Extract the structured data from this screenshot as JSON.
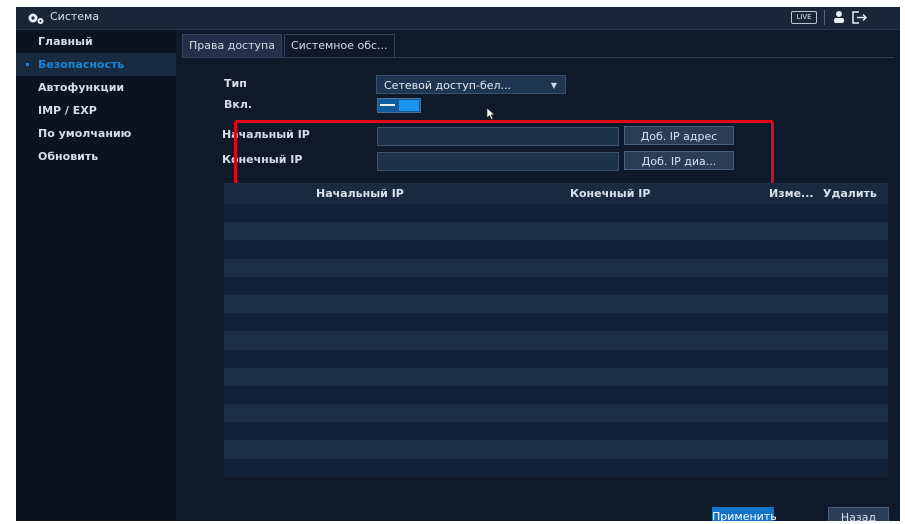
{
  "topbar": {
    "title": "Система",
    "live_label": "LIVE",
    "icons": [
      "gear-icon",
      "user-icon",
      "logout-icon"
    ]
  },
  "sidebar": {
    "items": [
      {
        "label": "Главный",
        "active": false
      },
      {
        "label": "Безопасность",
        "active": true
      },
      {
        "label": "Автофункции",
        "active": false
      },
      {
        "label": "IMP / EXP",
        "active": false
      },
      {
        "label": "По умолчанию",
        "active": false
      },
      {
        "label": "Обновить",
        "active": false
      }
    ]
  },
  "tabs": [
    {
      "label": "Права доступа",
      "active": true
    },
    {
      "label": "Системное обс...",
      "active": false
    }
  ],
  "form": {
    "type_label": "Тип",
    "type_value": "Сетевой доступ-бел...",
    "enable_label": "Вкл.",
    "enabled": true,
    "start_ip_label": "Начальный IP",
    "start_ip_value": "",
    "end_ip_label": "Конечный IP",
    "end_ip_value": "",
    "add_ip_button": "Доб. IP адрес",
    "add_range_button": "Доб. IP диа..."
  },
  "table": {
    "columns": [
      "Начальный IP",
      "Конечный IP",
      "Изме...",
      "Удалить"
    ],
    "rows": []
  },
  "footer": {
    "apply_label": "Применить",
    "back_label": "Назад"
  },
  "colors": {
    "accent": "#1687d8",
    "highlight_box": "#e3061a",
    "background": "#0e1a29"
  }
}
